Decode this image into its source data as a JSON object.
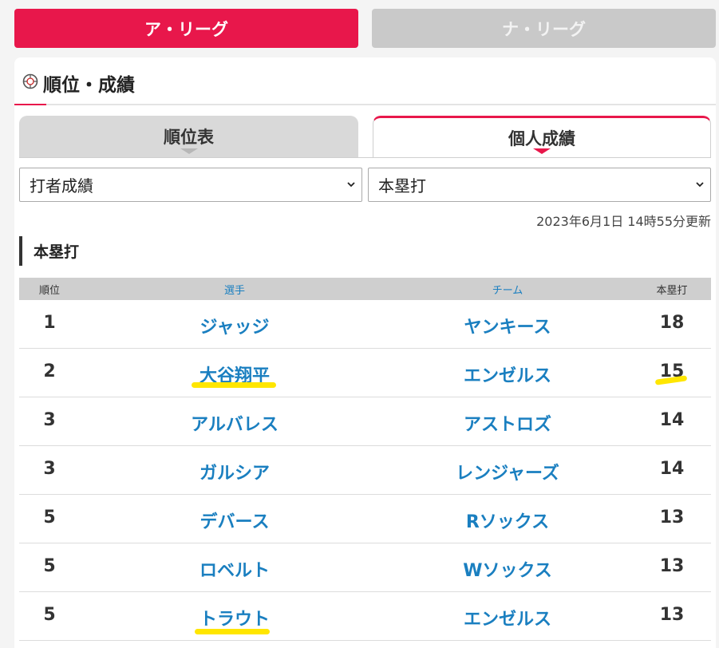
{
  "league_tabs": {
    "al": "ア・リーグ",
    "nl": "ナ・リーグ"
  },
  "section": {
    "title": "順位・成績"
  },
  "sub_tabs": {
    "rank": "順位表",
    "individual": "個人成績"
  },
  "selects": {
    "category": "打者成績",
    "stat": "本塁打"
  },
  "updated": "2023年6月1日 14時55分更新",
  "stat_title": "本塁打",
  "table": {
    "headers": [
      "順位",
      "選手",
      "チーム",
      "本塁打"
    ],
    "rows": [
      {
        "rank": "1",
        "player": "ジャッジ",
        "team": "ヤンキース",
        "value": "18"
      },
      {
        "rank": "2",
        "player": "大谷翔平",
        "team": "エンゼルス",
        "value": "15"
      },
      {
        "rank": "3",
        "player": "アルバレス",
        "team": "アストロズ",
        "value": "14"
      },
      {
        "rank": "3",
        "player": "ガルシア",
        "team": "レンジャーズ",
        "value": "14"
      },
      {
        "rank": "5",
        "player": "デバース",
        "team": "Rソックス",
        "value": "13"
      },
      {
        "rank": "5",
        "player": "ロベルト",
        "team": "Wソックス",
        "value": "13"
      },
      {
        "rank": "5",
        "player": "トラウト",
        "team": "エンゼルス",
        "value": "13"
      }
    ]
  },
  "colors": {
    "accent": "#e8174b",
    "link": "#1a7fc0",
    "highlight": "#ffe600"
  }
}
